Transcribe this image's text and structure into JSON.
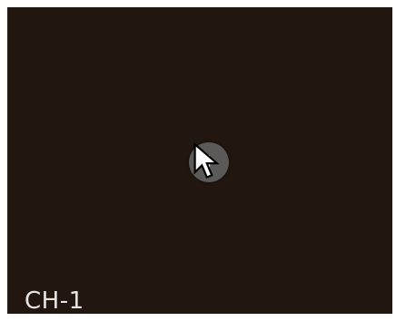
{
  "channel": {
    "label": "CH-1",
    "background_color": "#211710"
  },
  "add_button": {
    "icon": "plus-icon",
    "color": "#5c5a58"
  },
  "cursor": {
    "icon": "mouse-pointer-icon"
  }
}
